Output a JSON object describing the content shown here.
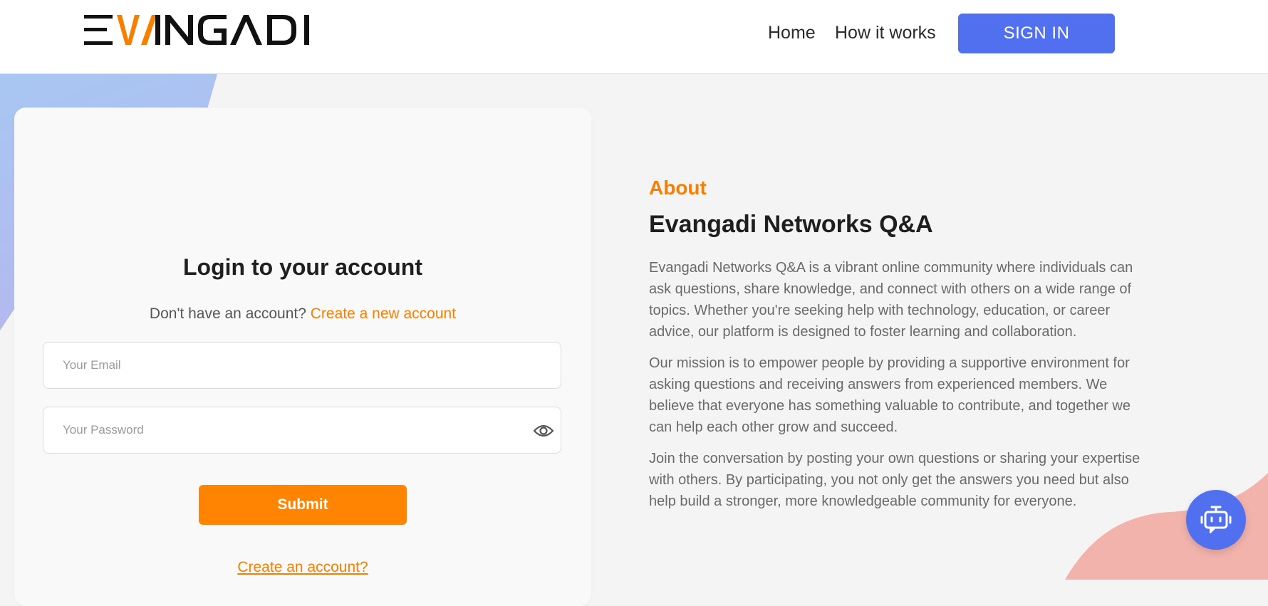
{
  "header": {
    "logo_text": "EVANGADI",
    "nav": {
      "home": "Home",
      "how_it_works": "How it works"
    },
    "signin_label": "SIGN IN"
  },
  "login": {
    "title": "Login to your account",
    "prompt": "Don't have an account?",
    "create_new_link": "Create a new account",
    "email_placeholder": "Your Email",
    "password_placeholder": "Your Password",
    "submit_label": "Submit",
    "create_account_link": "Create an account?"
  },
  "about": {
    "eyebrow": "About",
    "title": "Evangadi Networks Q&A",
    "paragraphs": [
      "Evangadi Networks Q&A is a vibrant online community where individuals can ask questions, share knowledge, and connect with others on a wide range of topics. Whether you're seeking help with technology, education, or career advice, our platform is designed to foster learning and collaboration.",
      "Our mission is to empower people by providing a supportive environment for asking questions and receiving answers from experienced members. We believe that everyone has something valuable to contribute, and together we can help each other grow and succeed.",
      "Join the conversation by posting your own questions or sharing your expertise with others. By participating, you not only get the answers you need but also help build a stronger, more knowledgeable community for everyone."
    ]
  },
  "colors": {
    "accent_orange": "#fe8402",
    "accent_blue": "#5170ef",
    "background": "#f4f4f4"
  },
  "icons": {
    "password_toggle": "eye-icon",
    "chat": "chatbot-icon"
  }
}
